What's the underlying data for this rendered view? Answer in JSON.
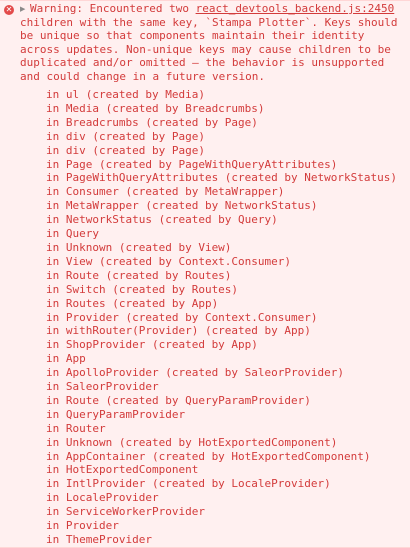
{
  "console": {
    "icon": "error-x-icon",
    "disclosure_icon": "triangle-right-icon",
    "message_prefix": "Warning: Encountered two ",
    "source_link": "react_devtools_backend.js:2450",
    "message_rest": "children with the same key, `Stampa Plotter`. Keys should be unique so that components maintain their identity across updates. Non-unique keys may cause children to be duplicated and/or omitted — the behavior is unsupported and could change in a future version.",
    "stack": [
      "in ul (created by Media)",
      "in Media (created by Breadcrumbs)",
      "in Breadcrumbs (created by Page)",
      "in div (created by Page)",
      "in div (created by Page)",
      "in Page (created by PageWithQueryAttributes)",
      "in PageWithQueryAttributes (created by NetworkStatus)",
      "in Consumer (created by MetaWrapper)",
      "in MetaWrapper (created by NetworkStatus)",
      "in NetworkStatus (created by Query)",
      "in Query",
      "in Unknown (created by View)",
      "in View (created by Context.Consumer)",
      "in Route (created by Routes)",
      "in Switch (created by Routes)",
      "in Routes (created by App)",
      "in Provider (created by Context.Consumer)",
      "in withRouter(Provider) (created by App)",
      "in ShopProvider (created by App)",
      "in App",
      "in ApolloProvider (created by SaleorProvider)",
      "in SaleorProvider",
      "in Route (created by QueryParamProvider)",
      "in QueryParamProvider",
      "in Router",
      "in Unknown (created by HotExportedComponent)",
      "in AppContainer (created by HotExportedComponent)",
      "in HotExportedComponent",
      "in IntlProvider (created by LocaleProvider)",
      "in LocaleProvider",
      "in ServiceWorkerProvider",
      "in Provider",
      "in ThemeProvider"
    ]
  },
  "colors": {
    "background": "#fff0f0",
    "text": "#d33b3b",
    "icon": "#e34b4b",
    "border": "#ffd6d6"
  }
}
